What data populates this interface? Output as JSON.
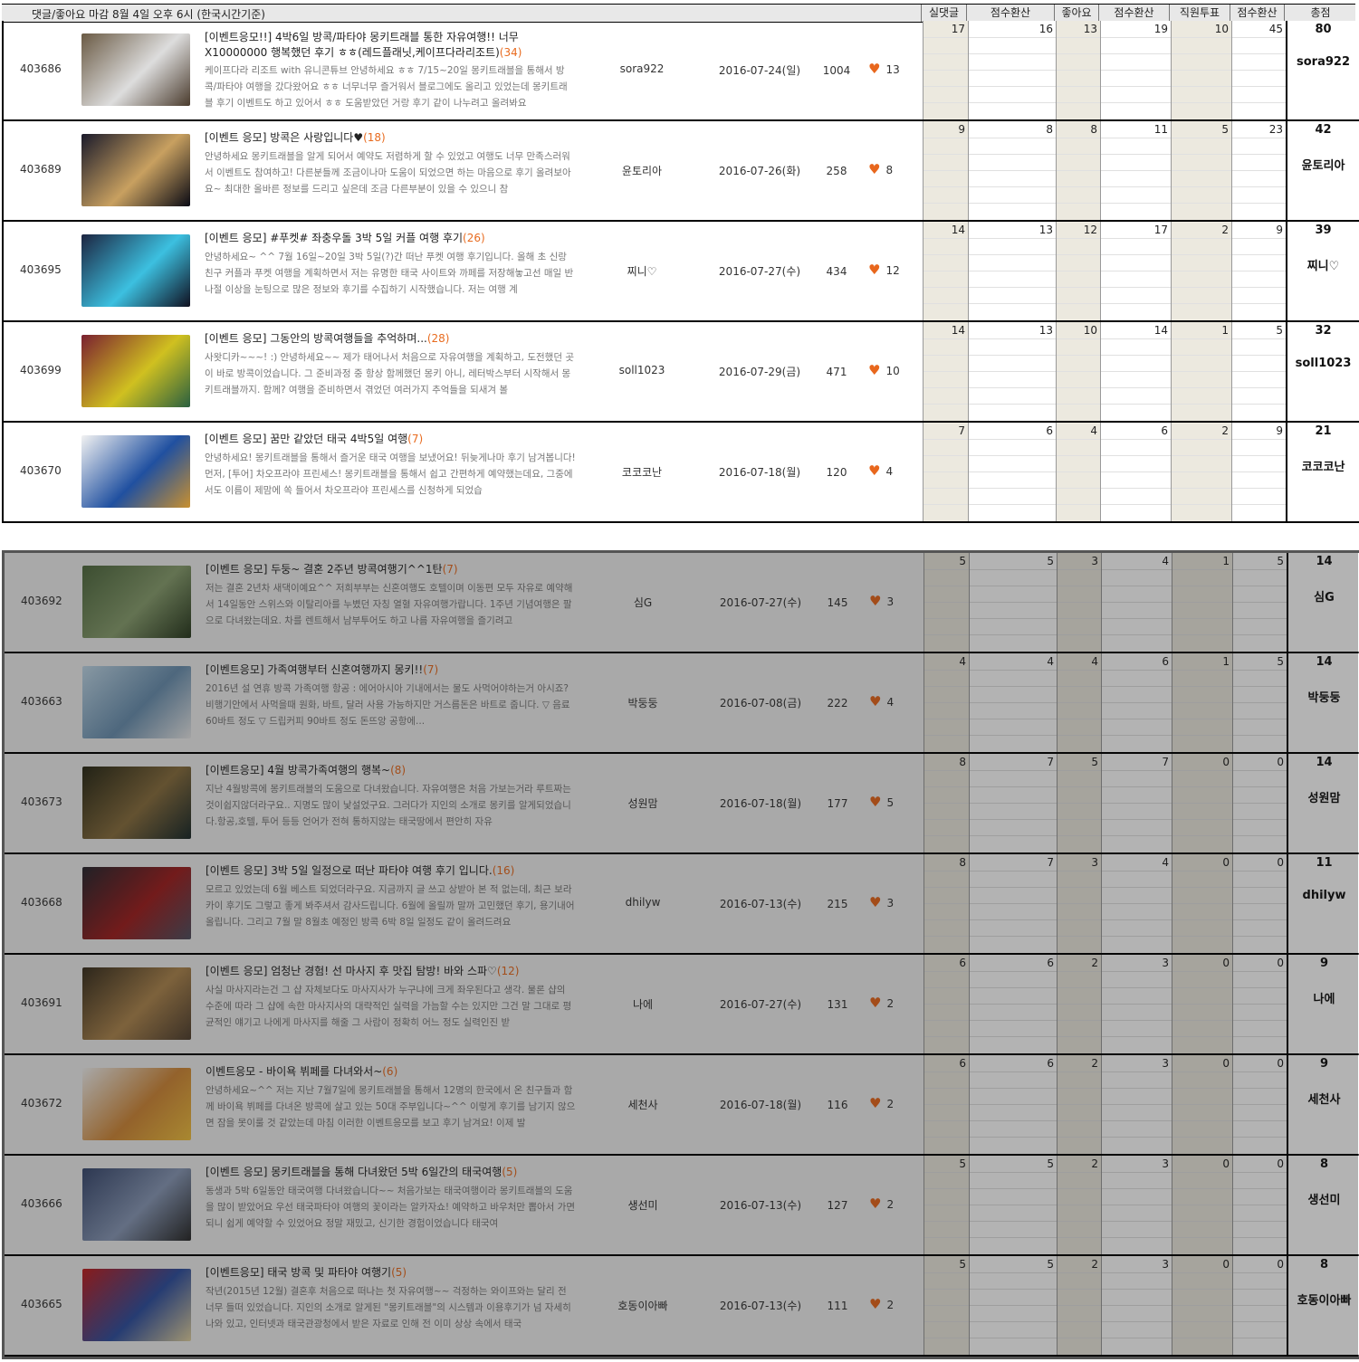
{
  "header": {
    "title": "댓글/좋아요 마감 8월 4일 오후 6시 (한국시간기준)",
    "columns": [
      "실댓글",
      "점수환산",
      "좋아요",
      "점수환산",
      "직원투표",
      "점수환산",
      "총점"
    ]
  },
  "colors": {
    "accent": "#e86b1f",
    "gray_cell": "#ece9df"
  },
  "active_rows": [
    {
      "id": "403686",
      "title": "[이벤트응모!!] 4박6일 방콕/파타야 몽키트래블 통한 자유여행!! 너무 X10000000 행복했던 후기 ㅎㅎ(레드플래닛,케이프다라리조트)",
      "count": "(34)",
      "excerpt": "케이프다라 리조트 with 유니콘튜브 안녕하세요 ㅎㅎ 7/15~20일 몽키트래블을 통해서 방콕/파타야 여행을 갔다왔어요 ㅎㅎ 너무너무 즐거워서 블로그에도 올리고 있었는데 몽키트래블 후기 이벤트도 하고 있어서 ㅎㅎ 도움받았던 거랑 후기 같이 나누려고 올려봐요",
      "author": "sora922",
      "date": "2016-07-24(일)",
      "views": "1004",
      "likes": "13",
      "scores": [
        "17",
        "16",
        "13",
        "19",
        "10",
        "45"
      ],
      "total": "80",
      "total_name": "sora922",
      "thumb": [
        "#6a5a44",
        "#ddd",
        "#4a3b2d"
      ]
    },
    {
      "id": "403689",
      "title": "[이벤트 응모] 방콕은 사랑입니다♥",
      "count": "(18)",
      "excerpt": "안녕하세요 몽키트래블을 알게 되어서 예약도 저렴하게 할 수 있었고 여행도 너무 만족스러워서 이벤트도 참여하고! 다른분들께 조금이나마 도움이 되었으면 하는 마음으로 후기 올려보아요~ 최대한 올바른 정보를 드리고 싶은데 조금 다른부분이 있을 수 있으니 참",
      "author": "윤토리아",
      "date": "2016-07-26(화)",
      "views": "258",
      "likes": "8",
      "scores": [
        "9",
        "8",
        "8",
        "11",
        "5",
        "23"
      ],
      "total": "42",
      "total_name": "윤토리아",
      "thumb": [
        "#1a1a2a",
        "#c8a060",
        "#0a0a14"
      ]
    },
    {
      "id": "403695",
      "title": "[이벤트 응모] #푸켓# 좌충우돌 3박 5일 커플 여행 후기",
      "count": "(26)",
      "excerpt": "안녕하세요~ ^^ 7월 16일~20일 3박 5일(?)간 떠난 푸켓 여행 후기입니다. 올해 초 신랑 친구 커플과 푸켓 여행을 계획하면서 저는 유명한 태국 사이트와 까페를 저장해놓고선 매일 반나절 이상을 눈팅으로 많은 정보와 후기를 수집하기 시작했습니다. 저는 여행 계",
      "author": "찌니♡",
      "date": "2016-07-27(수)",
      "views": "434",
      "likes": "12",
      "scores": [
        "14",
        "13",
        "12",
        "17",
        "2",
        "9"
      ],
      "total": "39",
      "total_name": "찌니♡",
      "thumb": [
        "#1c2440",
        "#3cc0e0",
        "#101020"
      ]
    },
    {
      "id": "403699",
      "title": "[이벤트 응모] 그동안의 방콕여행들을 추억하며...",
      "count": "(28)",
      "excerpt": "사왓디카~~~! :) 안녕하세요~~ 제가 태어나서 처음으로 자유여행을 계획하고, 도전했던 곳이 바로 방콕이었습니다. 그 준비과정 중 항상 함께했던 몽키 아니, 레터박스부터 시작해서 몽키트래블까지. 함께? 여행을 준비하면서 겪었던 여러가지 추억들을 되새겨 볼",
      "author": "soll1023",
      "date": "2016-07-29(금)",
      "views": "471",
      "likes": "10",
      "scores": [
        "14",
        "13",
        "10",
        "14",
        "1",
        "5"
      ],
      "total": "32",
      "total_name": "soll1023",
      "thumb": [
        "#7a2030",
        "#d0c020",
        "#2a6040"
      ]
    },
    {
      "id": "403670",
      "title": "[이벤트 응모] 꿈만 같았던 태국 4박5일 여행",
      "count": "(7)",
      "excerpt": "안녕하세요! 몽키트래블을 통해서 즐거운 태국 여행을 보냈어요! 뒤늦게나마 후기 남겨봅니다! 먼저, [투어] 차오프라야 프린세스! 몽키트래블을 통해서 쉽고 간편하게 예약했는데요, 그중에서도 이름이 제맘에 쏙 들어서 차오프라야 프린세스를 신청하게 되었습",
      "author": "코코코난",
      "date": "2016-07-18(월)",
      "views": "120",
      "likes": "4",
      "scores": [
        "7",
        "6",
        "4",
        "6",
        "2",
        "9"
      ],
      "total": "21",
      "total_name": "코코코난",
      "thumb": [
        "#f2f2f2",
        "#2050a0",
        "#c89030"
      ]
    }
  ],
  "dimmed_rows": [
    {
      "id": "403692",
      "title": "[이벤트 응모] 두둥~ 결혼 2주년 방콕여행기^^1탄",
      "count": "(7)",
      "excerpt": "저는 결혼 2년차 새댁이예요^^ 저희부부는 신혼여행도 호텔이며 이동편 모두 자유로 예약해서 14일동안 스위스와 이탈리아를 누볐던 자칭 열혈 자유여행가랍니다. 1주년 기념여행은 팔으로 다녀왔는데요. 차를 렌트해서 남부투어도 하고 나름 자유여행을 즐기려고",
      "author": "심G",
      "date": "2016-07-27(수)",
      "views": "145",
      "likes": "3",
      "scores": [
        "5",
        "5",
        "3",
        "4",
        "1",
        "5"
      ],
      "total": "14",
      "total_name": "심G",
      "thumb": [
        "#506a40",
        "#8aa070",
        "#2a3a20"
      ]
    },
    {
      "id": "403663",
      "title": "[이벤트응모] 가족여행부터 신혼여행까지 몽키!!",
      "count": "(7)",
      "excerpt": "2016년 설 연휴 방콕 가족여행 항공 : 에어아시아 기내에서는 물도 사먹어야하는거 아시죠? 비행기안에서 사먹을때 원화, 바트, 달러 사용 가능하지만 거스름돈은 바트로 줍니다. ▽ 음료 60바트 정도 ▽ 드립커피 90바트 정도 돈뜨앙 공항에...",
      "author": "박둥둥",
      "date": "2016-07-08(금)",
      "views": "222",
      "likes": "4",
      "scores": [
        "4",
        "4",
        "4",
        "6",
        "1",
        "5"
      ],
      "total": "14",
      "total_name": "박둥둥",
      "thumb": [
        "#c0d8e8",
        "#6a90b0",
        "#e8e8e8"
      ]
    },
    {
      "id": "403673",
      "title": "[이벤트응모] 4월 방콕가족여행의 행복~",
      "count": "(8)",
      "excerpt": "지난 4월방콕에 몽키트래블의 도움으로 다녀왔습니다. 자유여행은 처음 가보는거라 루트짜는것이쉽지않더라구요.. 지명도 많이 낯설었구요. 그러다가 지인의 소개로 몽키를 알게되었습니다.항공,호텔, 투어 등등 언어가 전혀 통하지않는 태국땅에서 편안히 자유",
      "author": "성원맘",
      "date": "2016-07-18(월)",
      "views": "177",
      "likes": "5",
      "scores": [
        "8",
        "7",
        "5",
        "7",
        "0",
        "0"
      ],
      "total": "14",
      "total_name": "성원맘",
      "thumb": [
        "#2a2a18",
        "#8a7040",
        "#1a2a2a"
      ]
    },
    {
      "id": "403668",
      "title": "[이벤트 응모] 3박 5일 일정으로 떠난 파타야 여행 후기 입니다.",
      "count": "(16)",
      "excerpt": "모르고 있었는데 6월 베스트 되었더라구요. 지금까지 글 쓰고 상받아 본 적 없는데, 최근 보라카이 후기도 그렇고 좋게 봐주셔서 감사드립니다. 6월에 올릴까 말까 고민했던 후기, 용기내어 올립니다. 그리고 7월 말 8월초 예정인 방콕 6박 8일 일정도 같이 올려드려요",
      "author": "dhilyw",
      "date": "2016-07-13(수)",
      "views": "215",
      "likes": "3",
      "scores": [
        "8",
        "7",
        "3",
        "4",
        "0",
        "0"
      ],
      "total": "11",
      "total_name": "dhilyw",
      "thumb": [
        "#282830",
        "#a02020",
        "#505060"
      ]
    },
    {
      "id": "403691",
      "title": "[이벤트 응모] 엄청난 경험! 선 마사지 후 맛집 탐방! 바와 스파♡",
      "count": "(12)",
      "excerpt": "사실 마사지라는건 그 샵 자체보다도 마사지사가 누구냐에 크게 좌우된다고 생각. 물론 샵의 수준에 따라 그 샵에 속한 마사지사의 대략적인 실력을 가늠할 수는 있지만 그건 말 그대로 평균적인 얘기고 나에게 마사지를 해줄 그 사람이 정확히 어느 정도 실력인진 받",
      "author": "나에",
      "date": "2016-07-27(수)",
      "views": "131",
      "likes": "2",
      "scores": [
        "6",
        "6",
        "2",
        "3",
        "0",
        "0"
      ],
      "total": "9",
      "total_name": "나에",
      "thumb": [
        "#3a3020",
        "#b08850",
        "#504030"
      ]
    },
    {
      "id": "403672",
      "title": "이벤트응모 - 바이욕 뷔페를 다녀와서~",
      "count": "(6)",
      "excerpt": "안녕하세요~^^ 저는 지난 7월7일에 몽키트래블을 통해서 12명의 한국에서 온 친구들과 함께 바이욕 뷔페를 다녀온 방콕에 살고 있는 50대 주부입니다~^^ 이렇게 후기를 남기지 않으면 잠을 못이룰 것 같았는데 마침 이러한 이벤트응모를 보고 후기 남겨요! 이제 발",
      "author": "세천사",
      "date": "2016-07-18(월)",
      "views": "116",
      "likes": "2",
      "scores": [
        "6",
        "6",
        "2",
        "3",
        "0",
        "0"
      ],
      "total": "9",
      "total_name": "세천사",
      "thumb": [
        "#f0f0f0",
        "#d08838",
        "#f0c040"
      ]
    },
    {
      "id": "403666",
      "title": "[이벤트 응모] 몽키트래블을 통해 다녀왔던 5박 6일간의 태국여행",
      "count": "(5)",
      "excerpt": "동생과 5박 6일동안 태국여행 다녀왔습니다~~ 처음가보는 태국여행이라 몽키트래블의 도움을 많이 받았어요 우선 태국파타야 여행의 꽃이라는 알카자쇼! 예약하고 바우처만 뽑아서 가면되니 쉽게 예약할 수 있었어요 정말 재밌고, 신기한 경험이었습니다 태국여",
      "author": "생선미",
      "date": "2016-07-13(수)",
      "views": "127",
      "likes": "2",
      "scores": [
        "5",
        "5",
        "2",
        "3",
        "0",
        "0"
      ],
      "total": "8",
      "total_name": "생선미",
      "thumb": [
        "#3a4a70",
        "#8a9ab8",
        "#2a2a2a"
      ]
    },
    {
      "id": "403665",
      "title": "[이벤트응모] 태국 방콕 및 파타야 여행기",
      "count": "(5)",
      "excerpt": "작년(2015년 12월) 결혼후 처음으로 떠나는 첫 자유여행~~ 걱정하는 와이프와는 달리 전 너무 들떠 있었습니다. 지인의 소개로 알게된 \"몽키트래블\"의 시스템과 이용후기가 넘 자세히 나와 있고, 인터넷과 태국관광청에서 받은 자료로 인해 전 이미 상상 속에서 태국",
      "author": "호동이아빠",
      "date": "2016-07-13(수)",
      "views": "111",
      "likes": "2",
      "scores": [
        "5",
        "5",
        "2",
        "3",
        "0",
        "0"
      ],
      "total": "8",
      "total_name": "호동이아빠",
      "thumb": [
        "#c02020",
        "#3050a0",
        "#e0d0a0"
      ]
    }
  ]
}
